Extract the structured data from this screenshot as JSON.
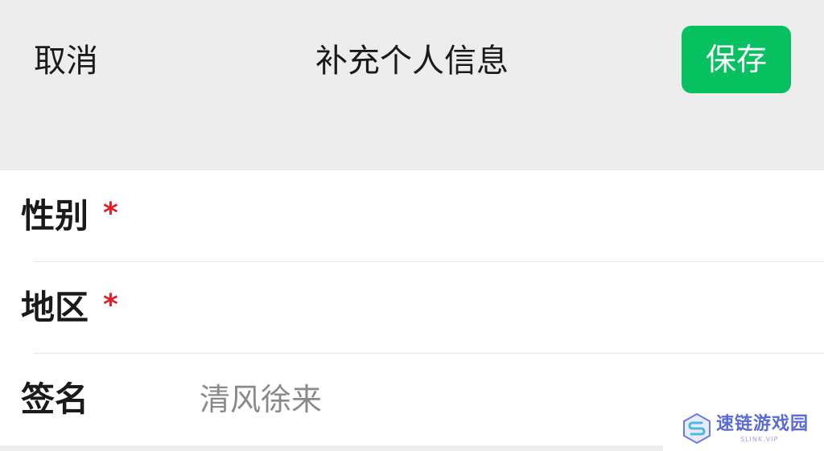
{
  "header": {
    "cancel_label": "取消",
    "title": "补充个人信息",
    "save_label": "保存"
  },
  "form": {
    "rows": [
      {
        "label": "性别",
        "required_mark": "*",
        "value": ""
      },
      {
        "label": "地区",
        "required_mark": "*",
        "value": ""
      },
      {
        "label": "签名",
        "required_mark": "",
        "value": "清风徐来"
      }
    ]
  },
  "watermark": {
    "text": "速链游戏园",
    "sub": "SLINK.VIP"
  },
  "colors": {
    "accent": "#07c160",
    "required": "#e0202a",
    "background": "#ededed"
  }
}
